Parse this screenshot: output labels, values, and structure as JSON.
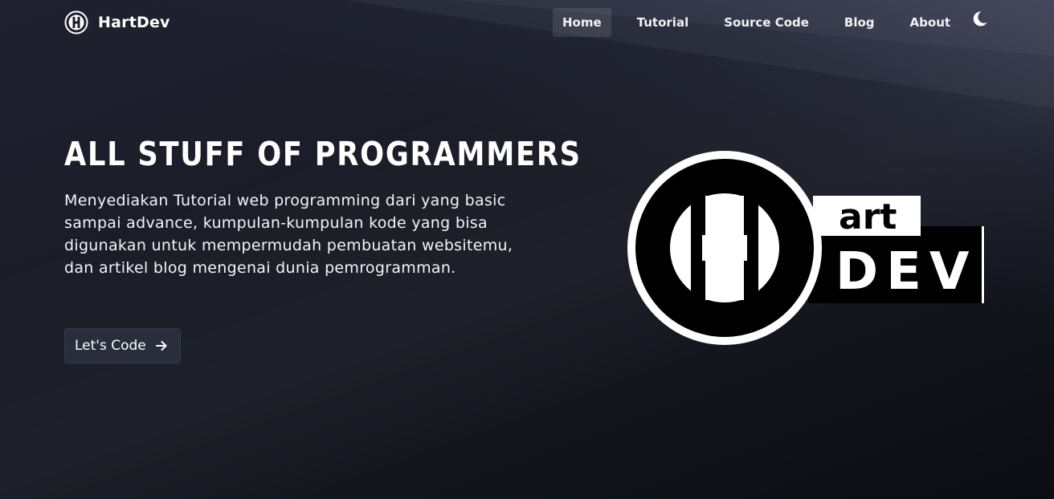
{
  "brand": {
    "name": "HartDev",
    "logo_icon": "h-circle-logo-icon"
  },
  "nav": {
    "items": [
      {
        "label": "Home",
        "active": true
      },
      {
        "label": "Tutorial",
        "active": false
      },
      {
        "label": "Source Code",
        "active": false
      },
      {
        "label": "Blog",
        "active": false
      },
      {
        "label": "About",
        "active": false
      }
    ],
    "theme_icon": "moon-icon"
  },
  "hero": {
    "title": "ALL STUFF OF PROGRAMMERS",
    "description": "Menyediakan Tutorial web programming dari yang basic sampai advance, kumpulan-kumpulan kode yang bisa digunakan untuk mempermudah pembuatan websitemu, dan artikel blog mengenai dunia pemrogramman.",
    "cta_label": "Let's Code",
    "cta_icon": "arrow-right-icon"
  },
  "logo_art": {
    "word_small": "art",
    "word_large": "DEV"
  },
  "colors": {
    "background": "#1a1c27",
    "text": "#ffffff",
    "button_bg": "#2a2e3c",
    "logo_black": "#000000",
    "logo_white": "#ffffff"
  }
}
